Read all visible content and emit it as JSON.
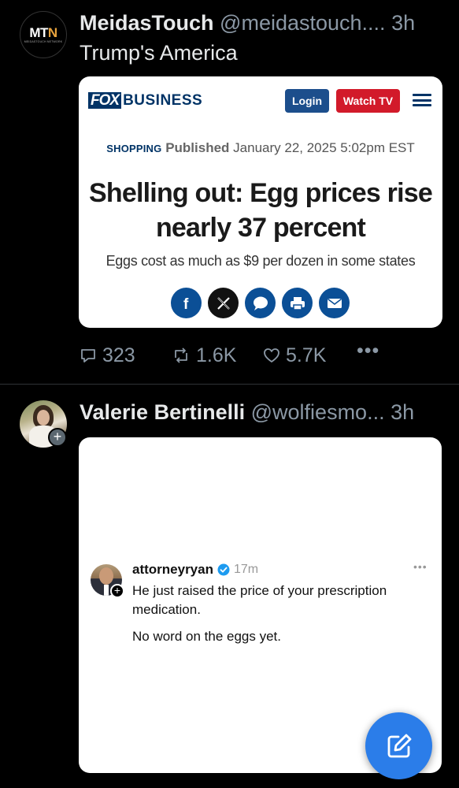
{
  "tweet1": {
    "avatar_text": "MTN",
    "avatar_subtext": "MEIDASTOUCH NETWORK",
    "display_name": "MeidasTouch",
    "handle": "@meidastouch....",
    "time": "3h",
    "text": "Trump's America",
    "card": {
      "logo_fox": "FOX",
      "logo_business": "BUSINESS",
      "login_label": "Login",
      "watch_tv_label": "Watch TV",
      "category": "SHOPPING",
      "published_label": "Published",
      "published_date": "January 22, 2025 5:02pm EST",
      "headline": "Shelling out: Egg prices rise nearly 37 percent",
      "subheadline": "Eggs cost as much as $9 per dozen in some states",
      "share_icons": [
        "facebook-icon",
        "x-icon",
        "comment-icon",
        "print-icon",
        "email-icon"
      ]
    },
    "actions": {
      "replies": "323",
      "retweets": "1.6K",
      "likes": "5.7K",
      "more": "•••"
    }
  },
  "tweet2": {
    "display_name": "Valerie Bertinelli",
    "handle": "@wolfiesmo...",
    "time": "3h",
    "embedded": {
      "username": "attorneyryan",
      "time": "17m",
      "more": "•••",
      "text_line1": "He just raised the price of your prescription medication.",
      "text_line2": "No word on the eggs yet."
    }
  },
  "colors": {
    "background": "#000000",
    "secondary_text": "#8b98a5",
    "fox_navy": "#003366",
    "watch_tv_red": "#d21a2a",
    "fab_blue": "#2b7de9"
  }
}
